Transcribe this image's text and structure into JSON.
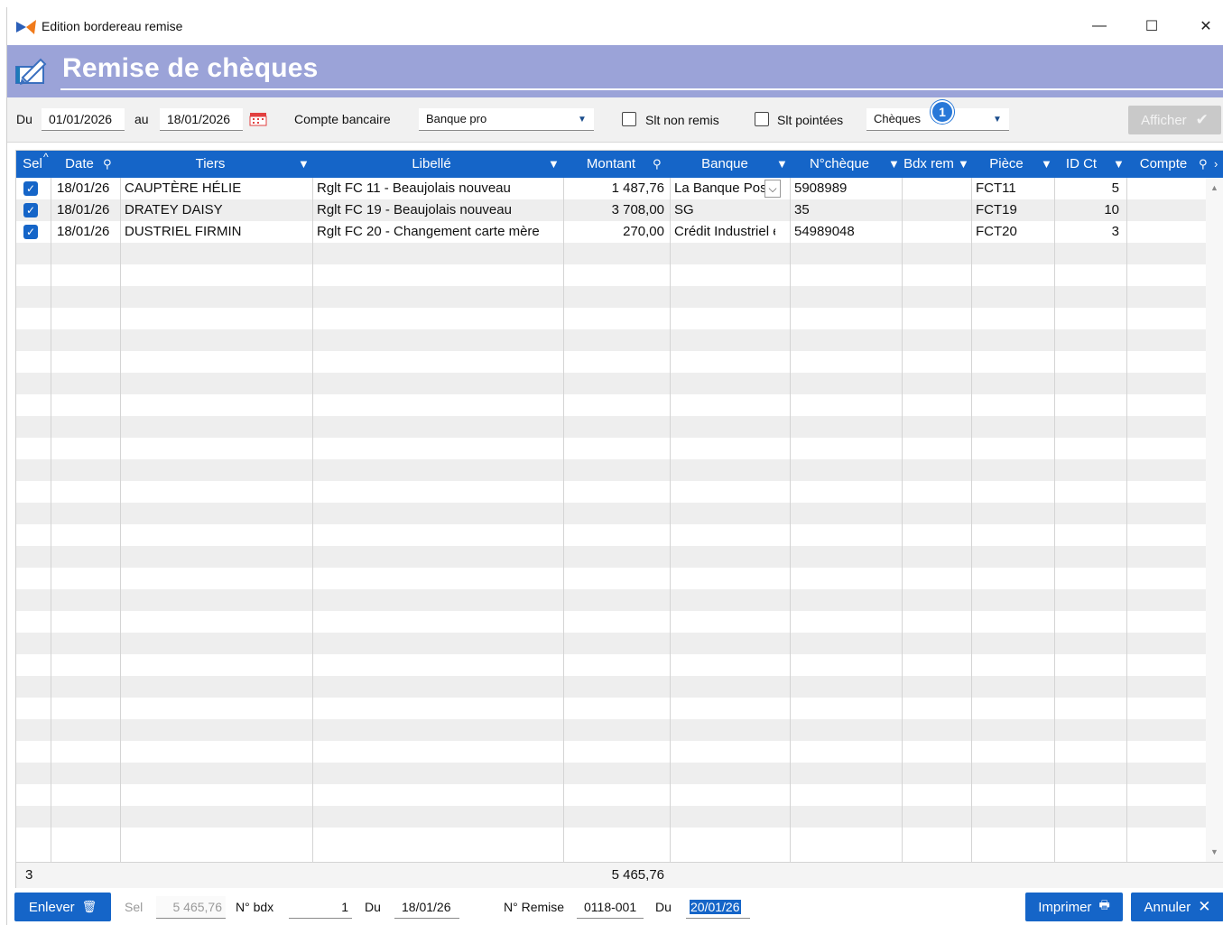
{
  "window": {
    "title": "Edition bordereau remise",
    "minimize_glyph": "—",
    "maximize_glyph": "☐",
    "close_glyph": "✕"
  },
  "banner": {
    "title": "Remise de chèques"
  },
  "filters": {
    "du_label": "Du",
    "date_from": "01/01/2026",
    "au_label": "au",
    "date_to": "18/01/2026",
    "compte_label": "Compte bancaire",
    "compte_value": "Banque pro",
    "slt_non_remis_label": "Slt non remis",
    "slt_pointees_label": "Slt pointées",
    "type_value": "Chèques",
    "badge_count": "1",
    "afficher_label": "Afficher"
  },
  "grid": {
    "columns": [
      {
        "label": "Sel"
      },
      {
        "label": "Date"
      },
      {
        "label": "Tiers"
      },
      {
        "label": "Libellé"
      },
      {
        "label": "Montant"
      },
      {
        "label": "Banque"
      },
      {
        "label": "N°chèque"
      },
      {
        "label": "Bdx rem"
      },
      {
        "label": "Pièce"
      },
      {
        "label": "ID Ct"
      },
      {
        "label": "Compte"
      }
    ],
    "rows": [
      {
        "date": "18/01/26",
        "tiers": "CAUPTÈRE HÉLIE",
        "libelle": "Rglt FC 11 - Beaujolais nouveau",
        "montant": "1 487,76",
        "banque": "La Banque Post",
        "cheque": "5908989",
        "bdx": "",
        "piece": "FCT11",
        "idct": "5",
        "compte": ""
      },
      {
        "date": "18/01/26",
        "tiers": "DRATEY DAISY",
        "libelle": "Rglt FC 19 - Beaujolais nouveau",
        "montant": "3 708,00",
        "banque": "SG",
        "cheque": "35",
        "bdx": "",
        "piece": "FCT19",
        "idct": "10",
        "compte": ""
      },
      {
        "date": "18/01/26",
        "tiers": "DUSTRIEL FIRMIN",
        "libelle": "Rglt FC 20 - Changement carte mère",
        "montant": "270,00",
        "banque": "Crédit Industriel e",
        "cheque": "54989048",
        "bdx": "",
        "piece": "FCT20",
        "idct": "3",
        "compte": ""
      }
    ],
    "footer": {
      "count": "3",
      "total": "5 465,76"
    }
  },
  "bottom": {
    "enlever_label": "Enlever",
    "sel_label": "Sel",
    "sel_value": "5 465,76",
    "nbdx_label": "N° bdx",
    "nbdx_value": "1",
    "du_label": "Du",
    "du_value": "18/01/26",
    "nremise_label": "N° Remise",
    "nremise_value": "0118-001",
    "du2_label": "Du",
    "du2_value": "20/01/26",
    "imprimer_label": "Imprimer",
    "annuler_label": "Annuler"
  },
  "colors": {
    "accent": "#1565c8",
    "banner": "#9ba3d8",
    "badge": "#2878d8",
    "disabled_button": "#c9c9c9"
  }
}
